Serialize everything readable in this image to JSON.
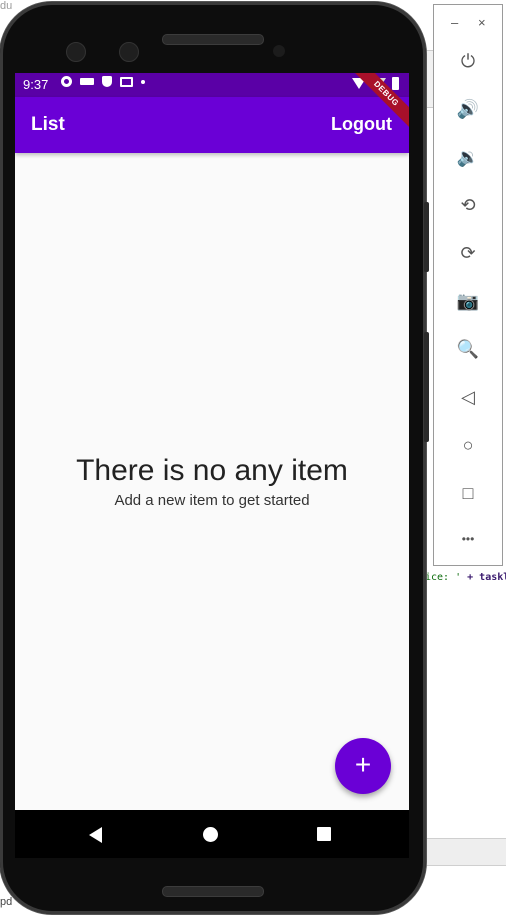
{
  "background": {
    "top_text": "du",
    "code_snippet_string": "ice: '",
    "code_snippet_rest": " + taskl",
    "bottom_left_text": "pd"
  },
  "status_bar": {
    "time": "9:37",
    "left_icons": [
      "settings-icon",
      "battery-saver-icon",
      "shield-icon",
      "mail-icon",
      "dot-icon"
    ],
    "right_icons": [
      "wifi-icon",
      "signal-icon",
      "battery-icon"
    ]
  },
  "app_bar": {
    "title": "List",
    "action_label": "Logout",
    "color": "#6a00d6"
  },
  "debug_banner": {
    "label": "DEBUG"
  },
  "empty_state": {
    "title": "There is no any item",
    "subtitle": "Add a new item to get started"
  },
  "fab": {
    "label": "+",
    "icon": "add-icon",
    "color": "#6a00d6"
  },
  "nav_bar": {
    "buttons": [
      "back-icon",
      "home-icon",
      "recents-icon"
    ]
  },
  "emulator_panel": {
    "minimize_label": "–",
    "close_label": "×",
    "tools": [
      {
        "name": "power-icon",
        "glyph": "⏻"
      },
      {
        "name": "volume-up-icon",
        "glyph": "🔊"
      },
      {
        "name": "volume-down-icon",
        "glyph": "🔉"
      },
      {
        "name": "rotate-left-icon",
        "glyph": "⟲"
      },
      {
        "name": "rotate-right-icon",
        "glyph": "⟳"
      },
      {
        "name": "camera-icon",
        "glyph": "📷"
      },
      {
        "name": "zoom-icon",
        "glyph": "🔍"
      },
      {
        "name": "back-icon",
        "glyph": "◁"
      },
      {
        "name": "home-icon",
        "glyph": "○"
      },
      {
        "name": "overview-icon",
        "glyph": "□"
      },
      {
        "name": "more-icon",
        "glyph": "•••"
      }
    ]
  }
}
